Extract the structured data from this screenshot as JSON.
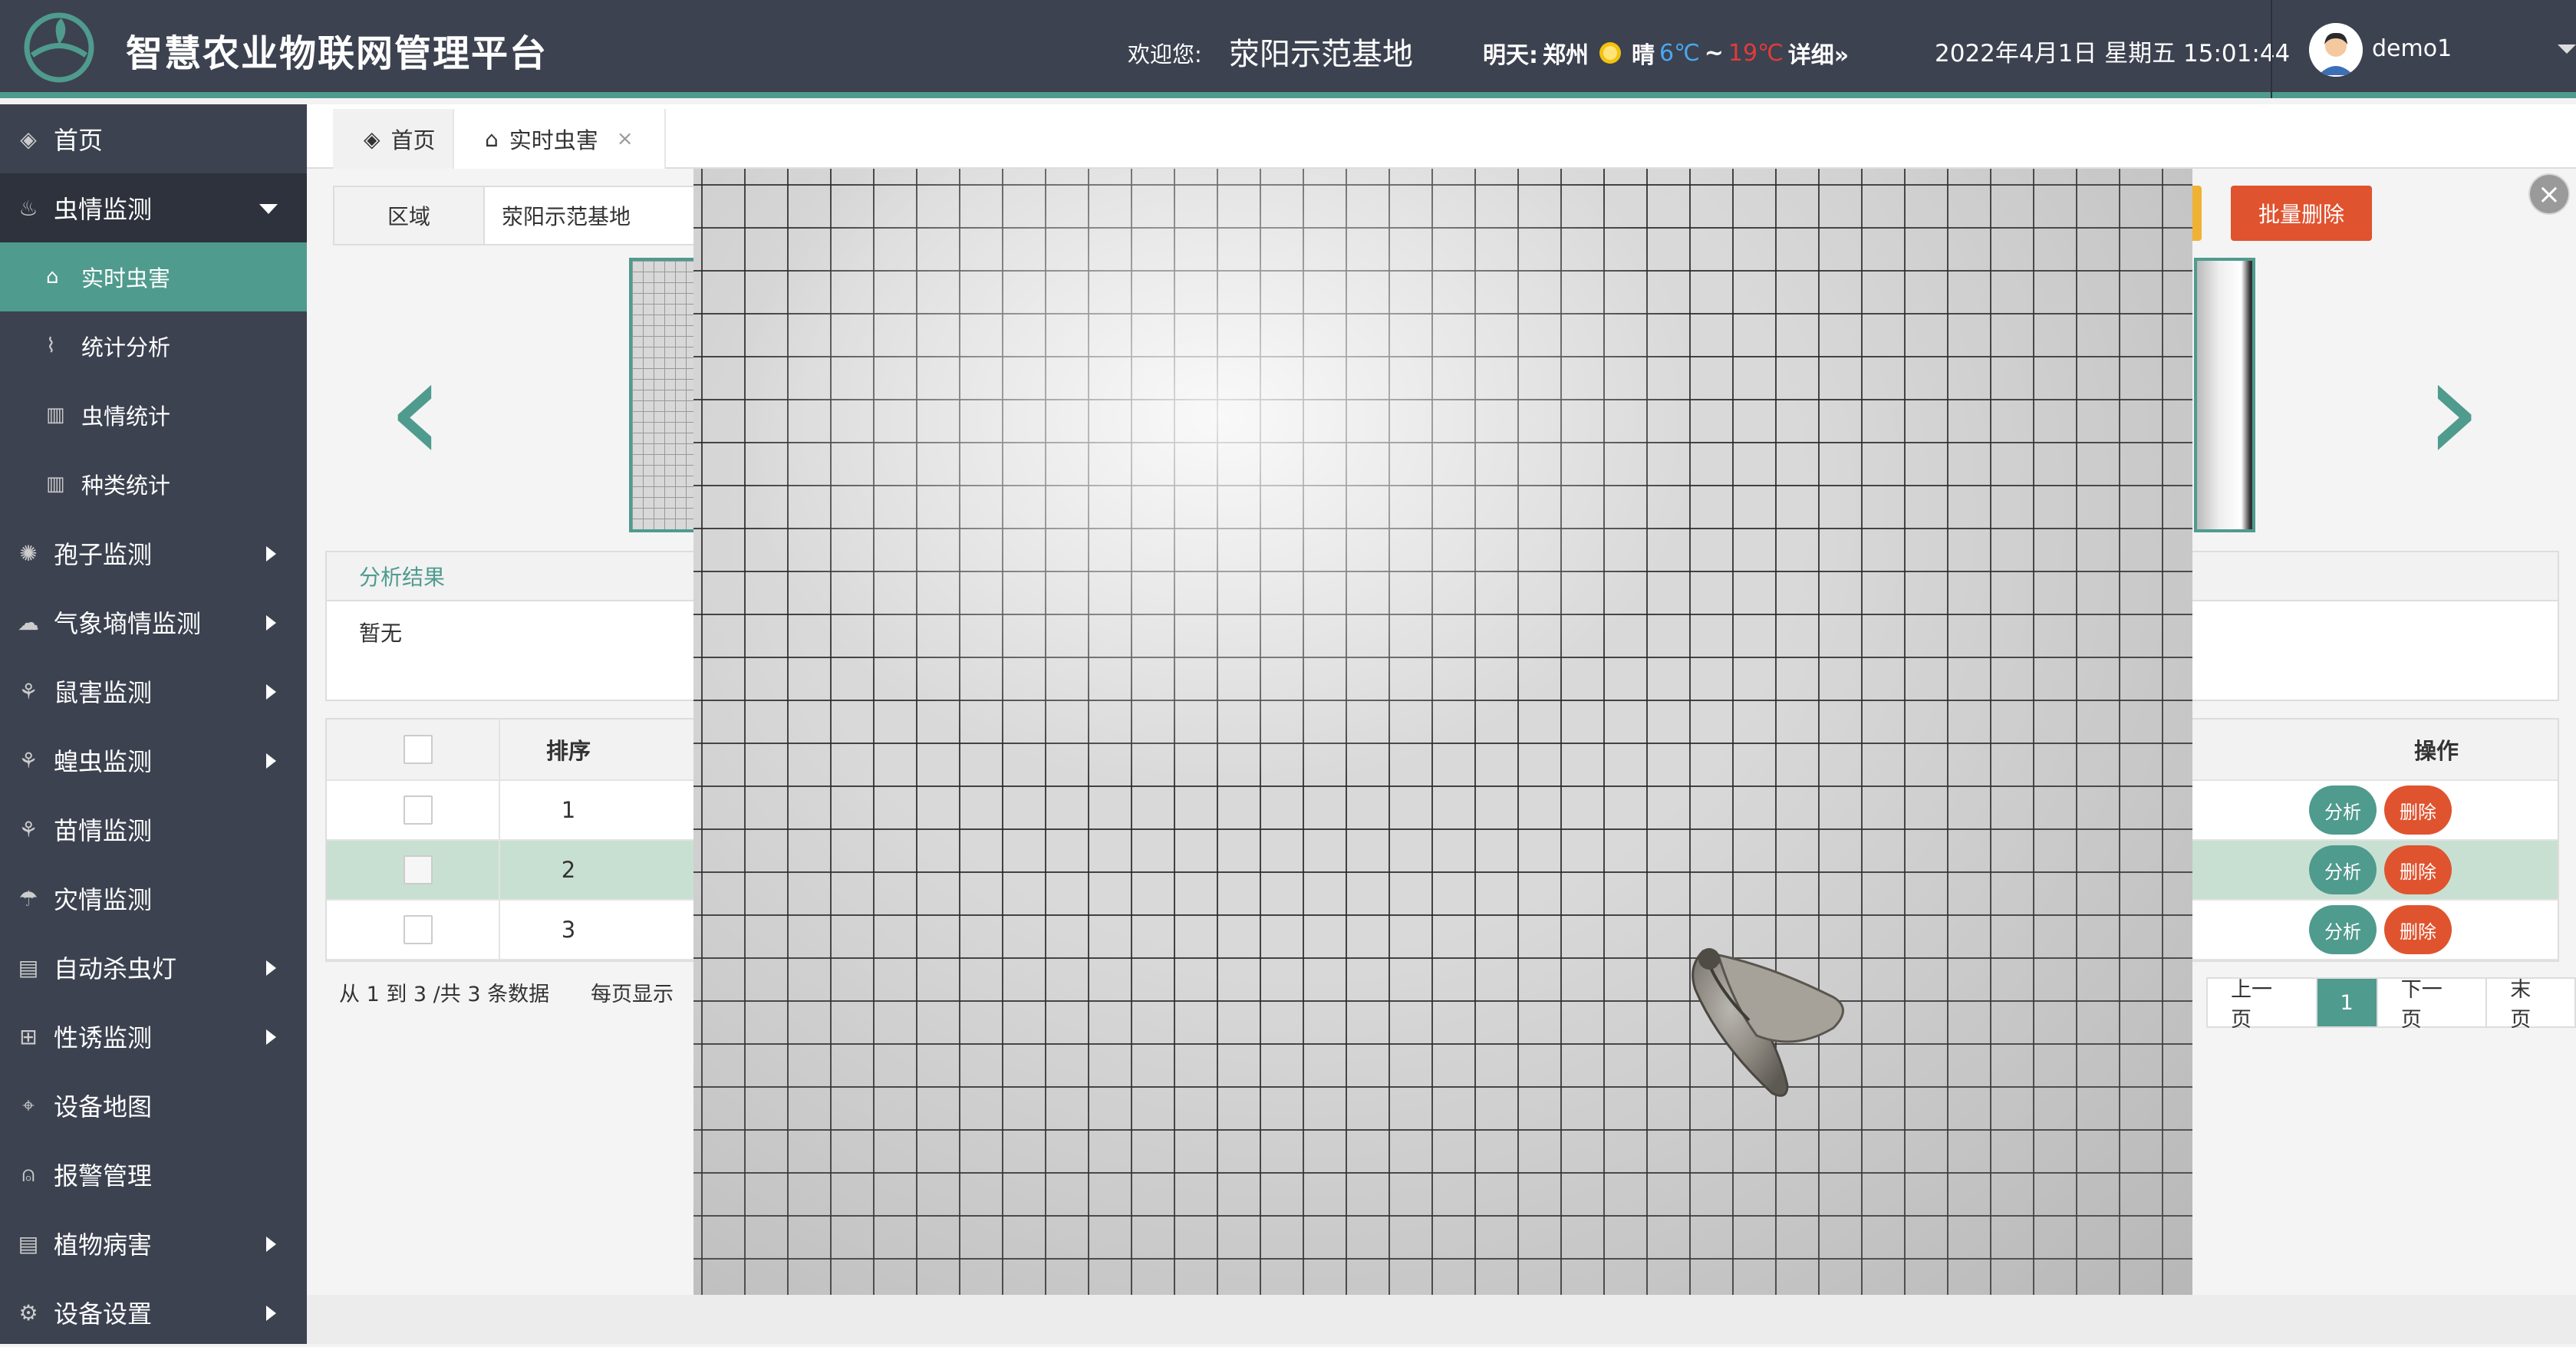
{
  "header": {
    "app_title": "智慧农业物联网管理平台",
    "welcome_label": "欢迎您:",
    "welcome_value": "荥阳示范基地",
    "weather": {
      "label": "明天:",
      "city": "郑州",
      "icon": "sun-icon",
      "condition": "晴",
      "low": "6℃",
      "tilde": "~",
      "high": "19℃",
      "detail": "详细»"
    },
    "datetime": "2022年4月1日  星期五   15:01:44",
    "username": "demo1",
    "colors": {
      "accent": "#4f9b8e",
      "bar": "#3c4250",
      "danger": "#e0532f",
      "warn": "#f0b234",
      "low_temp": "#49a7f0",
      "high_temp": "#e23b3b"
    }
  },
  "sidebar": {
    "items": [
      {
        "label": "首页",
        "icon": "layers-icon"
      },
      {
        "label": "虫情监测",
        "icon": "bug-icon",
        "open": true,
        "children": [
          {
            "label": "实时虫害",
            "icon": "bug-trap-icon",
            "active": true
          },
          {
            "label": "统计分析",
            "icon": "line-chart-icon"
          },
          {
            "label": "虫情统计",
            "icon": "bar-chart-icon"
          },
          {
            "label": "种类统计",
            "icon": "bar-chart-icon"
          }
        ]
      },
      {
        "label": "孢子监测",
        "icon": "virus-icon"
      },
      {
        "label": "气象墒情监测",
        "icon": "cloud-sun-icon"
      },
      {
        "label": "鼠害监测",
        "icon": "sprout-icon"
      },
      {
        "label": "蝗虫监测",
        "icon": "sprout-icon"
      },
      {
        "label": "苗情监测",
        "icon": "sprout-icon"
      },
      {
        "label": "灾情监测",
        "icon": "cloud-storm-icon"
      },
      {
        "label": "自动杀虫灯",
        "icon": "lamp-icon"
      },
      {
        "label": "性诱监测",
        "icon": "trap-icon"
      },
      {
        "label": "设备地图",
        "icon": "map-pin-icon"
      },
      {
        "label": "报警管理",
        "icon": "alarm-icon"
      },
      {
        "label": "植物病害",
        "icon": "document-icon"
      },
      {
        "label": "设备设置",
        "icon": "gear-icon"
      }
    ]
  },
  "tabs": [
    {
      "label": "首页",
      "icon": "layers-icon"
    },
    {
      "label": "实时虫害",
      "icon": "bug-trap-icon",
      "close": "×"
    }
  ],
  "filter": {
    "label": "区域",
    "value": "荥阳示范基地"
  },
  "toolbar": {
    "batch_delete": "批量删除"
  },
  "nav": {
    "prev": "‹",
    "next": "›"
  },
  "result": {
    "title": "分析结果",
    "body": "暂无"
  },
  "table": {
    "headers": {
      "order": "排序",
      "op": "操作"
    },
    "rows": [
      {
        "order": "1",
        "selected": false
      },
      {
        "order": "2",
        "selected": true
      },
      {
        "order": "3",
        "selected": false
      }
    ],
    "analyze_label": "分析",
    "delete_label": "删除"
  },
  "pager": {
    "info": "从 1 到 3 /共 3 条数据",
    "page_size_label": "每页显示",
    "prev": "上一页",
    "current": "1",
    "next": "下一页",
    "last": "末页"
  },
  "overlay": {
    "close": "×"
  }
}
